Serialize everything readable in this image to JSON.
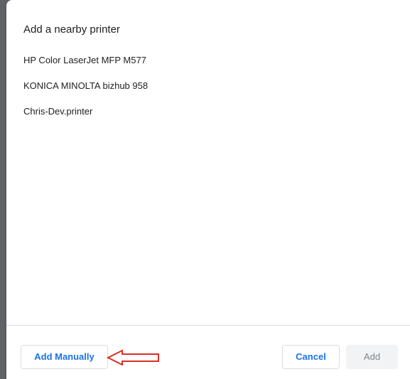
{
  "dialog": {
    "title": "Add a nearby printer"
  },
  "printers": [
    {
      "name": "HP Color LaserJet MFP M577"
    },
    {
      "name": "KONICA MINOLTA bizhub 958"
    },
    {
      "name": "Chris-Dev.printer"
    }
  ],
  "footer": {
    "add_manually_label": "Add Manually",
    "cancel_label": "Cancel",
    "add_label": "Add"
  },
  "colors": {
    "accent": "#1a73e8",
    "annotation": "#d93025",
    "disabled_bg": "#f1f3f4"
  }
}
